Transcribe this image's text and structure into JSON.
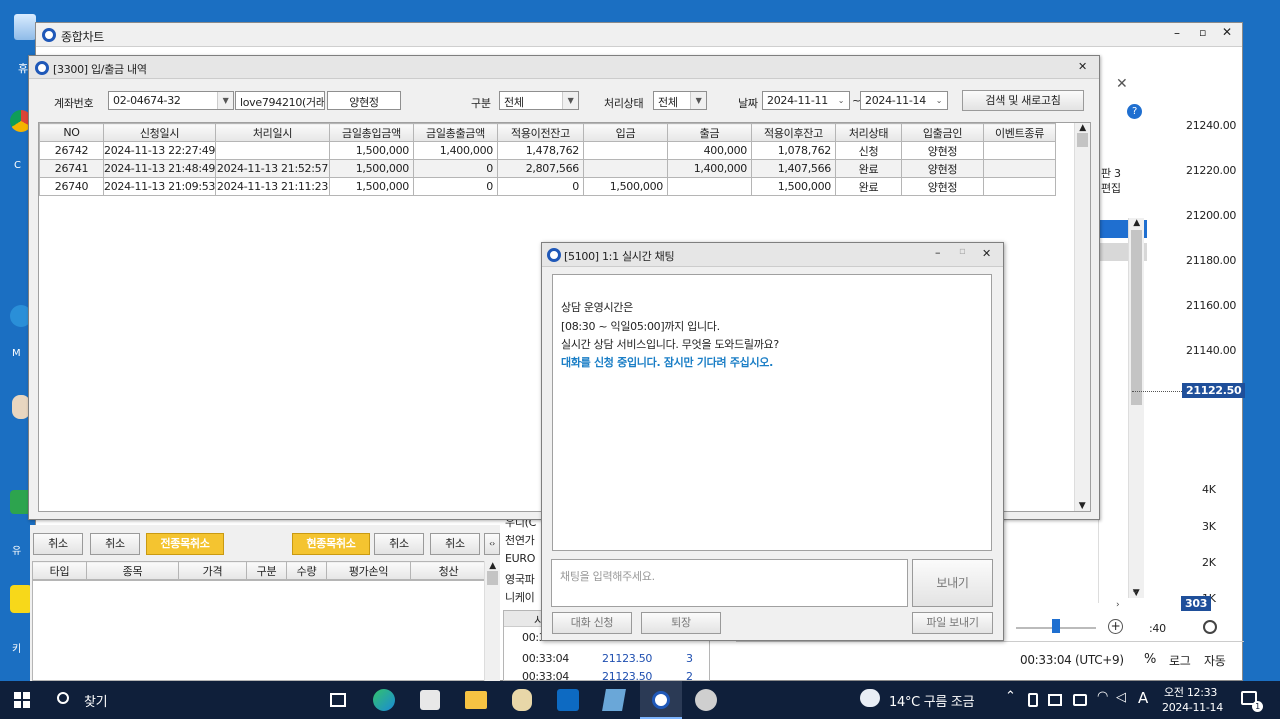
{
  "chart_window": {
    "title": "종합차트",
    "prices": [
      "21240.00",
      "21220.00",
      "21200.00",
      "21180.00",
      "21160.00",
      "21140.00"
    ],
    "current_price": "21122.50",
    "volumes": [
      "4K",
      "3K",
      "2K",
      "1K"
    ],
    "volume_badge": "303",
    "time": "00:33:04 (UTC+9)",
    "percent": "%",
    "log": "로그",
    "auto": "자동",
    "side_text_1": "판 3",
    "side_text_2": "편집",
    "time_short": ":40"
  },
  "deposit_window": {
    "title": "[3300] 입/출금 내역",
    "account_label": "계좌번호",
    "account_value": "02-04674-32",
    "user_id": "love794210(거래)",
    "name": "양현정",
    "type_label": "구분",
    "type_value": "전체",
    "status_label": "처리상태",
    "status_value": "전체",
    "date_label": "날짜",
    "date_from": "2024-11-11",
    "tilde": "~",
    "date_to": "2024-11-14",
    "search_button": "검색 및 새로고침",
    "columns": [
      "NO",
      "신청일시",
      "처리일시",
      "금일총입금액",
      "금일총출금액",
      "적용이전잔고",
      "입금",
      "출금",
      "적용이후잔고",
      "처리상태",
      "입출금인",
      "이벤트종류"
    ],
    "rows": [
      [
        "26742",
        "2024-11-13 22:27:49",
        "",
        "1,500,000",
        "1,400,000",
        "1,478,762",
        "",
        "400,000",
        "1,078,762",
        "신청",
        "양현정",
        ""
      ],
      [
        "26741",
        "2024-11-13 21:48:49",
        "2024-11-13 21:52:57",
        "1,500,000",
        "0",
        "2,807,566",
        "",
        "1,400,000",
        "1,407,566",
        "완료",
        "양현정",
        ""
      ],
      [
        "26740",
        "2024-11-13 21:09:53",
        "2024-11-13 21:11:23",
        "1,500,000",
        "0",
        "0",
        "1,500,000",
        "",
        "1,500,000",
        "완료",
        "양현정",
        ""
      ]
    ]
  },
  "order_panel": {
    "buttons": [
      "취소",
      "취소",
      "전종목취소",
      "현종목취소",
      "취소",
      "취소"
    ],
    "columns": [
      "타입",
      "종목",
      "가격",
      "구분",
      "수량",
      "평가손익",
      "청산"
    ],
    "instruments": [
      "우디(C",
      "천연가",
      "EURO",
      "영국파",
      "니케이"
    ],
    "ticks": [
      [
        "00:33:04",
        "21123.50",
        "3"
      ],
      [
        "00:33:04",
        "21123.50",
        "2"
      ]
    ],
    "tick_head": "시",
    "tick_partial": "00:3"
  },
  "chat_window": {
    "title": "[5100] 1:1 실시간 채팅",
    "lines": [
      "상담 운영시간은",
      "[08:30 ~ 익일05:00]까지 입니다.",
      "실시간 상담 서비스입니다. 무엇을 도와드릴까요?"
    ],
    "highlight": "대화를 신청 중입니다. 잠시만 기다려 주십시오.",
    "input_placeholder": "채팅을 입력해주세요.",
    "send_button": "보내기",
    "request_button": "대화 신청",
    "leave_button": "퇴장",
    "file_button": "파일 보내기"
  },
  "desktop": {
    "icon_labels": [
      "휴",
      "C",
      "M",
      "유",
      "키"
    ]
  },
  "taskbar": {
    "search": "찾기",
    "weather": "14°C  구름 조금",
    "ime": "A",
    "clock_time": "오전 12:33",
    "clock_date": "2024-11-14",
    "notif_count": "1"
  }
}
